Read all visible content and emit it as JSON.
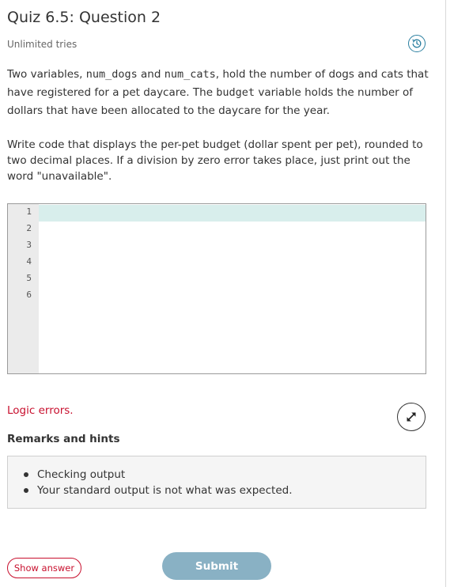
{
  "quiz": {
    "title": "Quiz 6.5: Question 2",
    "tries": "Unlimited tries"
  },
  "prompt": {
    "p1_a": "Two variables, ",
    "var_dogs": "num_dogs",
    "p1_b": " and ",
    "var_cats": "num_cats",
    "p1_c": ", hold the number of dogs and cats that have registered for a pet daycare. The ",
    "var_budget": "budget",
    "p1_d": " variable holds the number of dollars that have been allocated to the daycare for the year.",
    "p2": "Write code that displays the per-pet budget (dollar spent per pet), rounded to two decimal places. If a division by zero error takes place, just print out the word \"unavailable\"."
  },
  "editor": {
    "line_numbers": [
      "1",
      "2",
      "3",
      "4",
      "5",
      "6"
    ],
    "code": ""
  },
  "result": {
    "status": "Logic errors.",
    "remarks_title": "Remarks and hints",
    "hints": [
      "Checking output",
      "Your standard output is not what was expected."
    ]
  },
  "actions": {
    "show_answer": "Show answer",
    "submit": "Submit"
  },
  "colors": {
    "error": "#c8102e",
    "accent": "#2a7fa0",
    "submit_bg": "#89b1c4",
    "active_line": "#d8eeec"
  },
  "icons": {
    "history": "history-icon",
    "expand": "expand-icon"
  }
}
